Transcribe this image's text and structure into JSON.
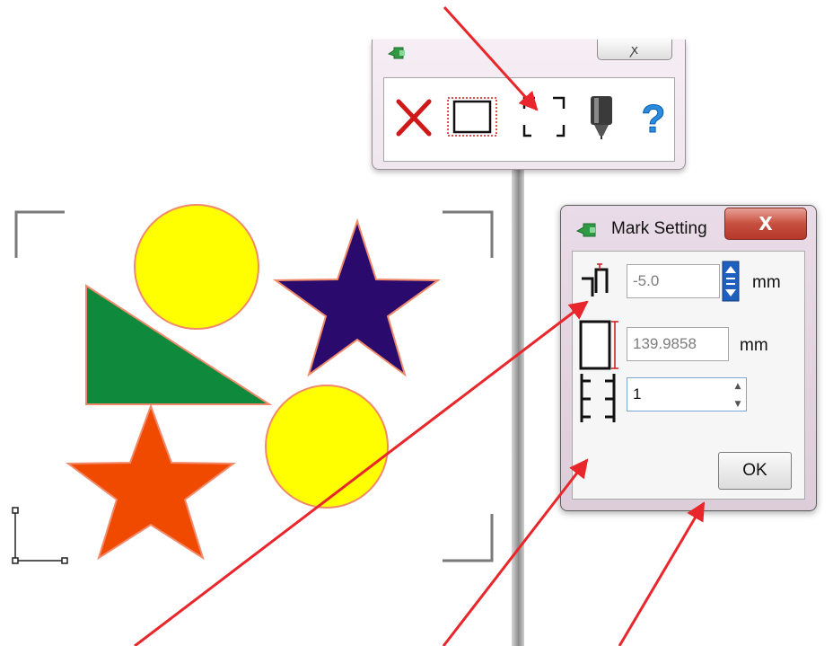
{
  "toolbar_window": {
    "close_symbol": "ꭗ",
    "tools": [
      {
        "name": "delete-icon"
      },
      {
        "name": "rectangle-selection-icon"
      },
      {
        "name": "registration-marks-icon"
      },
      {
        "name": "cutter-blade-icon"
      },
      {
        "name": "help-icon"
      }
    ]
  },
  "mark_setting_dialog": {
    "title": "Mark Setting",
    "close_symbol": "X",
    "offset": {
      "value": "-5.0",
      "unit": "mm"
    },
    "size": {
      "value": "139.9858",
      "unit": "mm"
    },
    "count": {
      "value": "1"
    },
    "ok_label": "OK"
  },
  "canvas": {
    "shapes": [
      {
        "type": "circle",
        "color": "#ffff00"
      },
      {
        "type": "star",
        "color": "#2b0a6e"
      },
      {
        "type": "triangle",
        "color": "#0f8a3c"
      },
      {
        "type": "circle",
        "color": "#ffff00"
      },
      {
        "type": "star",
        "color": "#f04a00"
      }
    ]
  },
  "annotation_color": "#e8262b"
}
